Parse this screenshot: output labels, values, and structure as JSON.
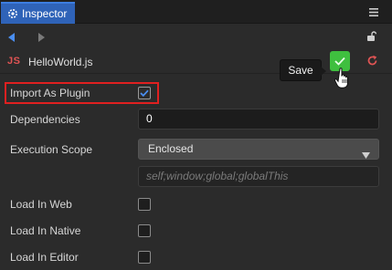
{
  "panel": {
    "tab_label": "Inspector",
    "tab_icon": "gear-icon",
    "menu_icon": "hamburger-menu-icon",
    "accent_color": "#2f63b8"
  },
  "nav": {
    "back_icon": "arrow-left-icon",
    "forward_icon": "arrow-right-icon",
    "lock_icon": "unlock-icon"
  },
  "file": {
    "badge": "JS",
    "name": "HelloWorld.js",
    "apply_icon": "checkmark-icon",
    "apply_color": "#3fbf3f",
    "revert_icon": "revert-icon",
    "revert_color": "#e05454",
    "tooltip": "Save"
  },
  "properties": {
    "import_as_plugin": {
      "label": "Import As Plugin",
      "checked": true
    },
    "dependencies": {
      "label": "Dependencies",
      "value": "0"
    },
    "execution_scope": {
      "label": "Execution Scope",
      "selected": "Enclosed"
    },
    "global_vars": {
      "placeholder": "self;window;global;globalThis"
    },
    "load_in_web": {
      "label": "Load In Web",
      "checked": false
    },
    "load_in_native": {
      "label": "Load In Native",
      "checked": false
    },
    "load_in_editor": {
      "label": "Load In Editor",
      "checked": false
    }
  }
}
